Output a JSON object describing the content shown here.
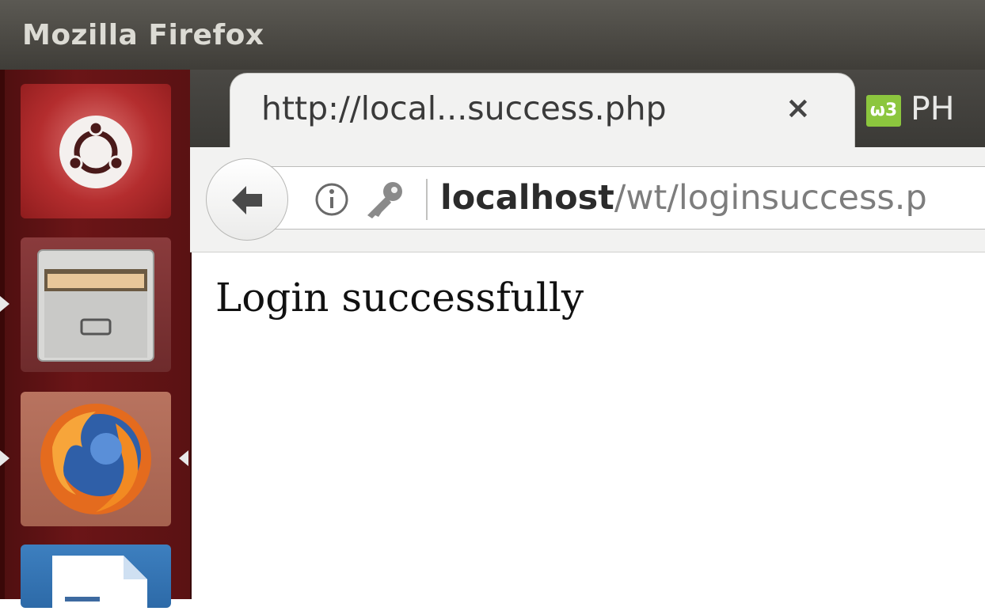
{
  "window": {
    "title": "Mozilla Firefox"
  },
  "launcher": {
    "items": [
      {
        "name": "Dash",
        "icon": "ubuntu-logo-icon"
      },
      {
        "name": "Files",
        "icon": "file-cabinet-icon"
      },
      {
        "name": "Firefox Web Browser",
        "icon": "firefox-icon"
      },
      {
        "name": "LibreOffice Writer",
        "icon": "writer-document-icon"
      }
    ]
  },
  "tabs": [
    {
      "title": "http://local...success.php",
      "close": "×",
      "active": true
    },
    {
      "title": "PH",
      "icon_text": "ω3",
      "active": false
    }
  ],
  "urlbar": {
    "host": "localhost",
    "path": "/wt/loginsuccess.p"
  },
  "page": {
    "text": "Login successfully"
  },
  "colors": {
    "launcher": "#6b1517",
    "titlebar": "#4a4844",
    "w3_green": "#8cc63e"
  }
}
